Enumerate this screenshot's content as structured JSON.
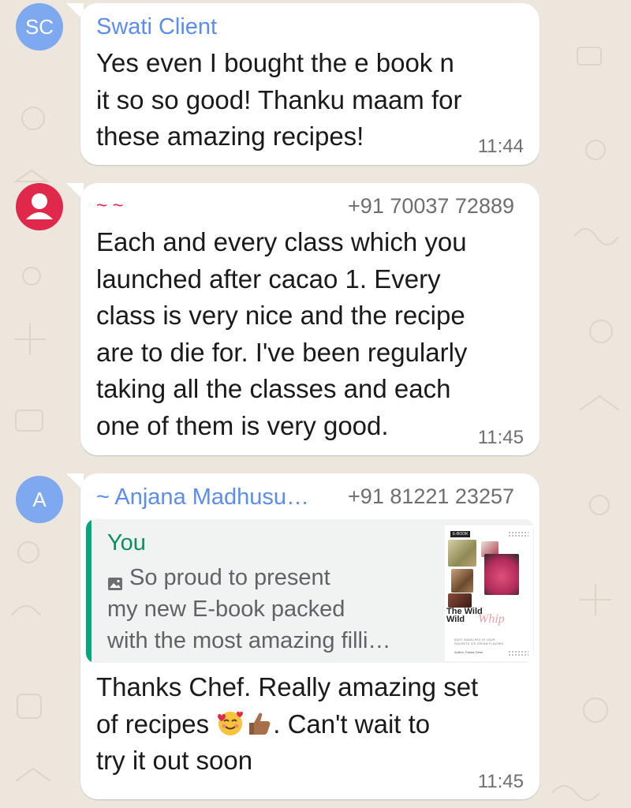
{
  "colors": {
    "background": "#ece6dd",
    "bubble": "#ffffff",
    "sender1": "#5b8def",
    "sender2": "#e0294a",
    "sender3": "#5b8def",
    "quote_accent": "#06a87a"
  },
  "messages": [
    {
      "avatar_initials": "SC",
      "avatar_color": "#7ea8f0",
      "sender": "Swati Client",
      "sender_color": "#5b8def",
      "text": "Yes even I bought the e book  n\nit so so good! Thanku maam for\nthese amazing recipes!",
      "time": "11:44"
    },
    {
      "avatar_icon": "person-icon",
      "avatar_color": "#e0294a",
      "sender": "~ ~",
      "sender_color": "#e0294a",
      "phone": "+91 70037 72889",
      "text": "Each and every class which you\nlaunched after cacao 1. Every\nclass is very nice and the recipe\nare to die for. I've been regularly\ntaking all the classes and each\none of them is very good.",
      "time": "11:45"
    },
    {
      "avatar_initials": "A",
      "avatar_color": "#7ea8f0",
      "sender": "~ Anjana Madhusu…",
      "sender_color": "#5b8def",
      "phone": "+91 81221 23257",
      "quote": {
        "author": "You",
        "icon": "image-icon",
        "text": "So proud to present\nmy new E-book packed\nwith the most amazing filli…",
        "thumbnail": {
          "tag": "E-BOOK",
          "title": "The Wild\nWild",
          "script": "Whip",
          "subtitle": "EASY GANACHES IN YOUR\nFAVORITE ICE CREAM FLAVORS",
          "author": "Author: Farida Taher"
        }
      },
      "text_line1": "Thanks Chef. Really amazing set",
      "text_line2_start": "of recipes ",
      "emojis": [
        "smiling-face-with-hearts-emoji",
        "thumbs-up-emoji"
      ],
      "text_line2_end": ". Can't wait to",
      "text_line3": "try it out soon",
      "time": "11:45"
    }
  ]
}
